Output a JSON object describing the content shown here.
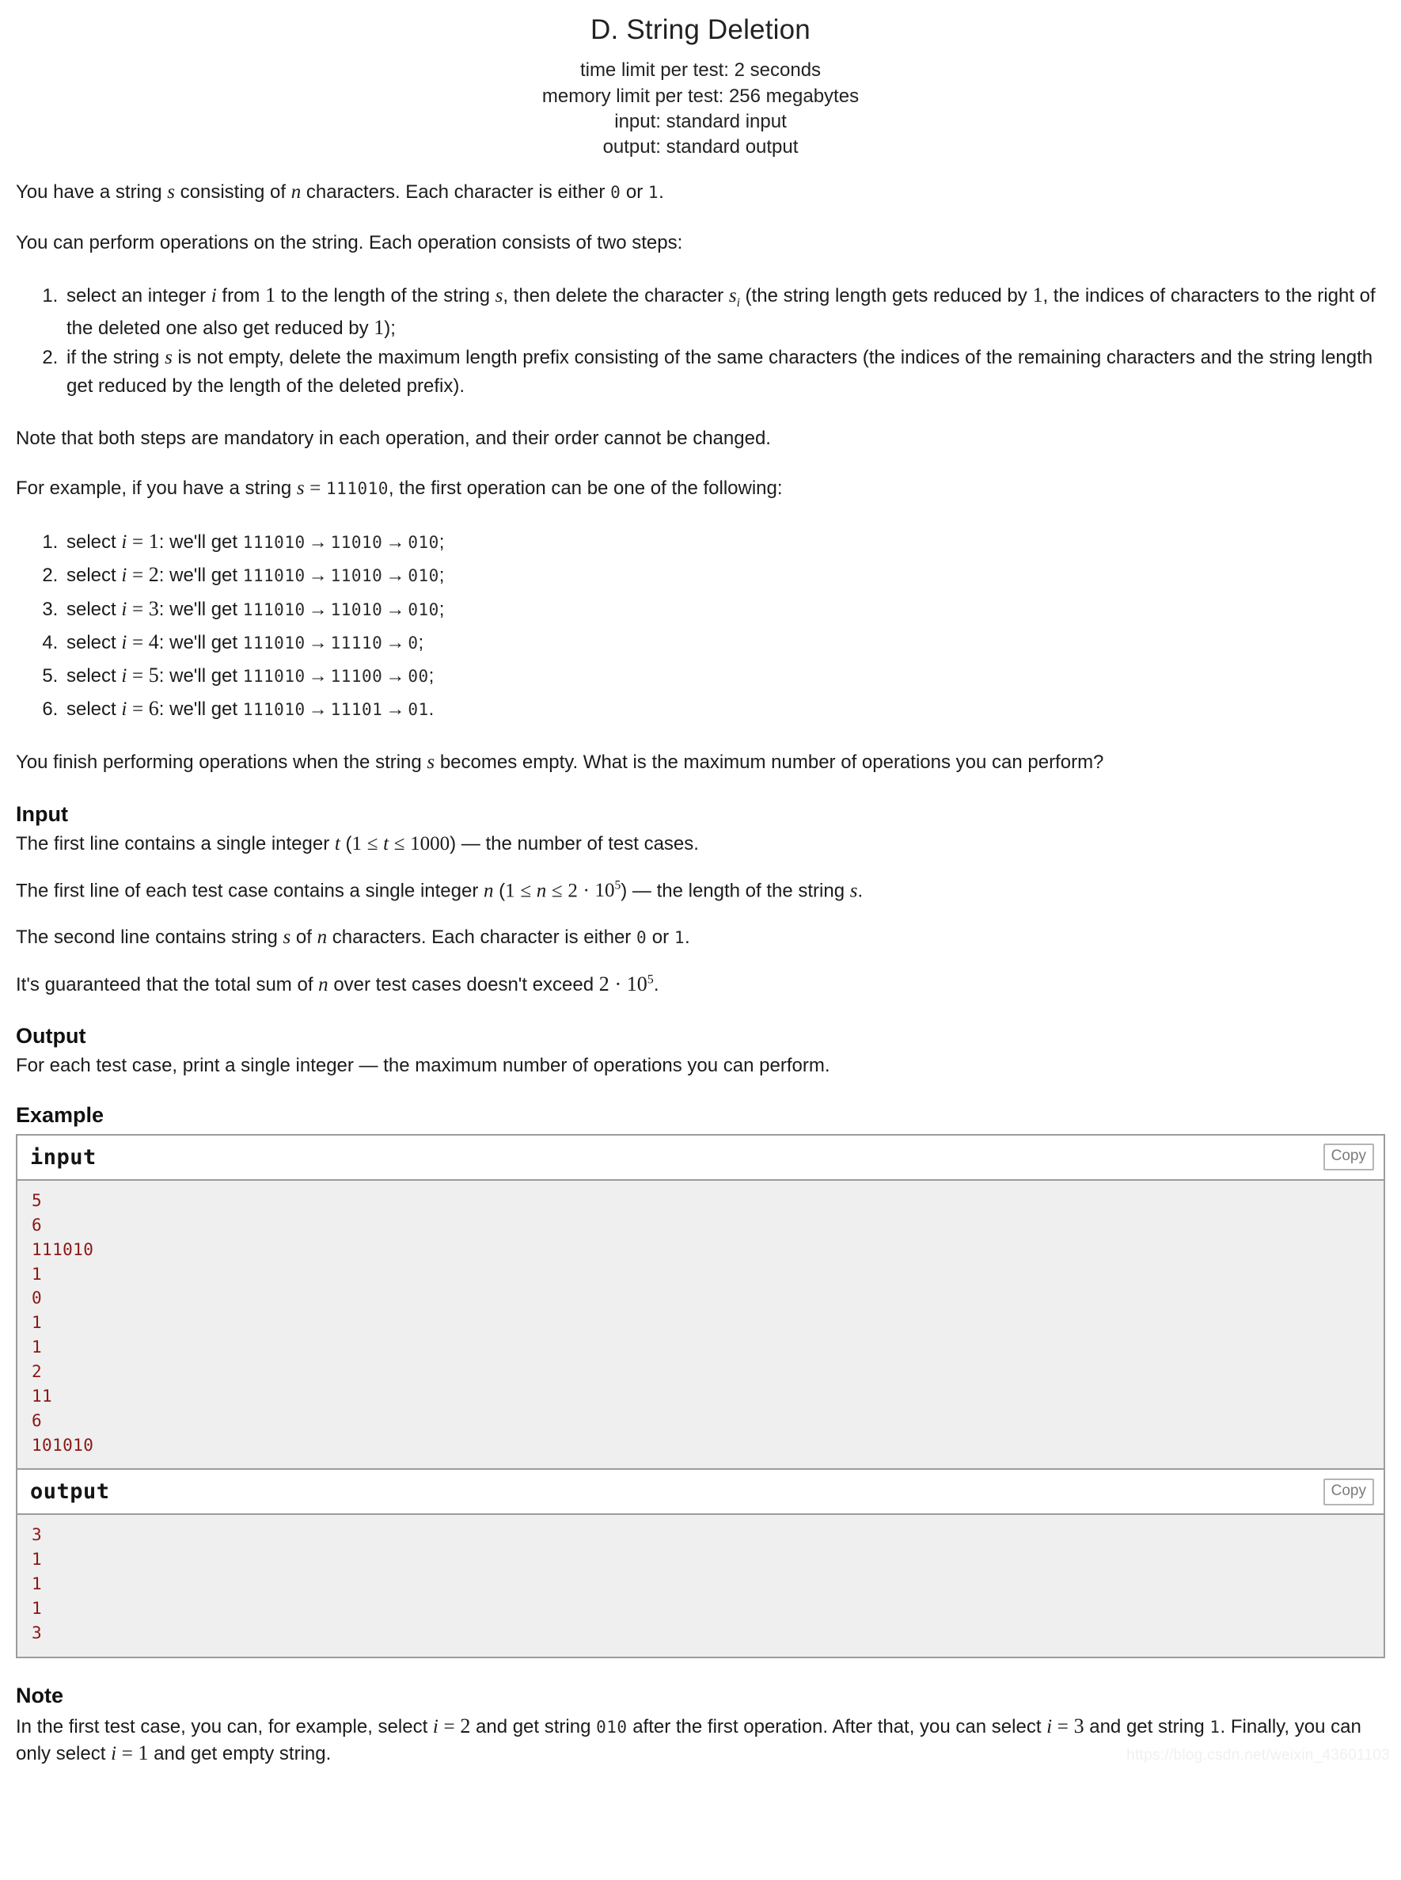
{
  "header": {
    "title": "D. String Deletion",
    "limits": [
      "time limit per test: 2 seconds",
      "memory limit per test: 256 megabytes",
      "input: standard input",
      "output: standard output"
    ]
  },
  "statement": {
    "p1_a": "You have a string ",
    "p1_s": "s",
    "p1_b": " consisting of ",
    "p1_n": "n",
    "p1_c": " characters. Each character is either ",
    "p1_zero": "0",
    "p1_d": " or ",
    "p1_one": "1",
    "p1_e": ".",
    "p2": "You can perform operations on the string. Each operation consists of two steps:",
    "step1_a": "select an integer ",
    "step1_i": "i",
    "step1_b": " from ",
    "step1_one": "1",
    "step1_c": " to the length of the string ",
    "step1_s": "s",
    "step1_d": ", then delete the character ",
    "step1_si": "s",
    "step1_si_sub": "i",
    "step1_e": " (the string length gets reduced by ",
    "step1_one2": "1",
    "step1_f": ", the indices of characters to the right of the deleted one also get reduced by ",
    "step1_one3": "1",
    "step1_g": ");",
    "step2_a": "if the string ",
    "step2_s": "s",
    "step2_b": " is not empty, delete the maximum length prefix consisting of the same characters (the indices of the remaining characters and the string length get reduced by the length of the deleted prefix).",
    "p3": "Note that both steps are mandatory in each operation, and their order cannot be changed.",
    "p4_a": "For example, if you have a string ",
    "p4_s": "s",
    "p4_eq": "=",
    "p4_val": "111010",
    "p4_b": ", the first operation can be one of the following:",
    "p5_a": "You finish performing operations when the string ",
    "p5_s": "s",
    "p5_b": " becomes empty. What is the maximum number of operations you can perform?"
  },
  "example_ops": {
    "prefix": "select ",
    "var": "i",
    "eq": "=",
    "mid": ": we'll get ",
    "arrow": "→",
    "items": [
      {
        "i": "1",
        "from": "111010",
        "step1": "11010",
        "step2": "010",
        "end": ";"
      },
      {
        "i": "2",
        "from": "111010",
        "step1": "11010",
        "step2": "010",
        "end": ";"
      },
      {
        "i": "3",
        "from": "111010",
        "step1": "11010",
        "step2": "010",
        "end": ";"
      },
      {
        "i": "4",
        "from": "111010",
        "step1": "11110",
        "step2": "0",
        "end": ";"
      },
      {
        "i": "5",
        "from": "111010",
        "step1": "11100",
        "step2": "00",
        "end": ";"
      },
      {
        "i": "6",
        "from": "111010",
        "step1": "11101",
        "step2": "01",
        "end": "."
      }
    ]
  },
  "input_section": {
    "heading": "Input",
    "l1_a": "The first line contains a single integer ",
    "l1_t": "t",
    "l1_paren_open": "(",
    "l1_one": "1",
    "l1_le1": "≤",
    "l1_t2": "t",
    "l1_le2": "≤",
    "l1_1000": "1000",
    "l1_paren_close": ")",
    "l1_b": " — the number of test cases.",
    "l2_a": "The first line of each test case contains a single integer ",
    "l2_n": "n",
    "l2_paren_open": "(",
    "l2_one": "1",
    "l2_le1": "≤",
    "l2_n2": "n",
    "l2_le2": "≤",
    "l2_two": "2",
    "l2_dot": "·",
    "l2_ten": "10",
    "l2_exp": "5",
    "l2_paren_close": ")",
    "l2_b": " — the length of the string ",
    "l2_s": "s",
    "l2_c": ".",
    "l3_a": "The second line contains string ",
    "l3_s": "s",
    "l3_b": " of ",
    "l3_n": "n",
    "l3_c": " characters. Each character is either ",
    "l3_zero": "0",
    "l3_d": " or ",
    "l3_one": "1",
    "l3_e": ".",
    "l4_a": "It's guaranteed that the total sum of ",
    "l4_n": "n",
    "l4_b": " over test cases doesn't exceed ",
    "l4_two": "2",
    "l4_dot": "·",
    "l4_ten": "10",
    "l4_exp": "5",
    "l4_c": "."
  },
  "output_section": {
    "heading": "Output",
    "text": "For each test case, print a single integer — the maximum number of operations you can perform."
  },
  "example_section": {
    "heading": "Example",
    "input_label": "input",
    "output_label": "output",
    "copy_label": "Copy",
    "input_data": "5\n6\n111010\n1\n0\n1\n1\n2\n11\n6\n101010",
    "output_data": "3\n1\n1\n1\n3"
  },
  "note_section": {
    "heading": "Note",
    "a": "In the first test case, you can, for example, select ",
    "i1": "i",
    "eq1": "=",
    "v1": "2",
    "b": " and get string ",
    "s1": "010",
    "c": " after the first operation. After that, you can select ",
    "i2": "i",
    "eq2": "=",
    "v2": "3",
    "d": " and get string ",
    "s2": "1",
    "e": ". Finally, you can only select ",
    "i3": "i",
    "eq3": "=",
    "v3": "1",
    "f": " and get empty string."
  },
  "watermark": "https://blog.csdn.net/weixin_43601103",
  "colors": {
    "sample_text": "#8b1717",
    "sample_bg": "#efefef",
    "border": "#9c9c9c"
  }
}
